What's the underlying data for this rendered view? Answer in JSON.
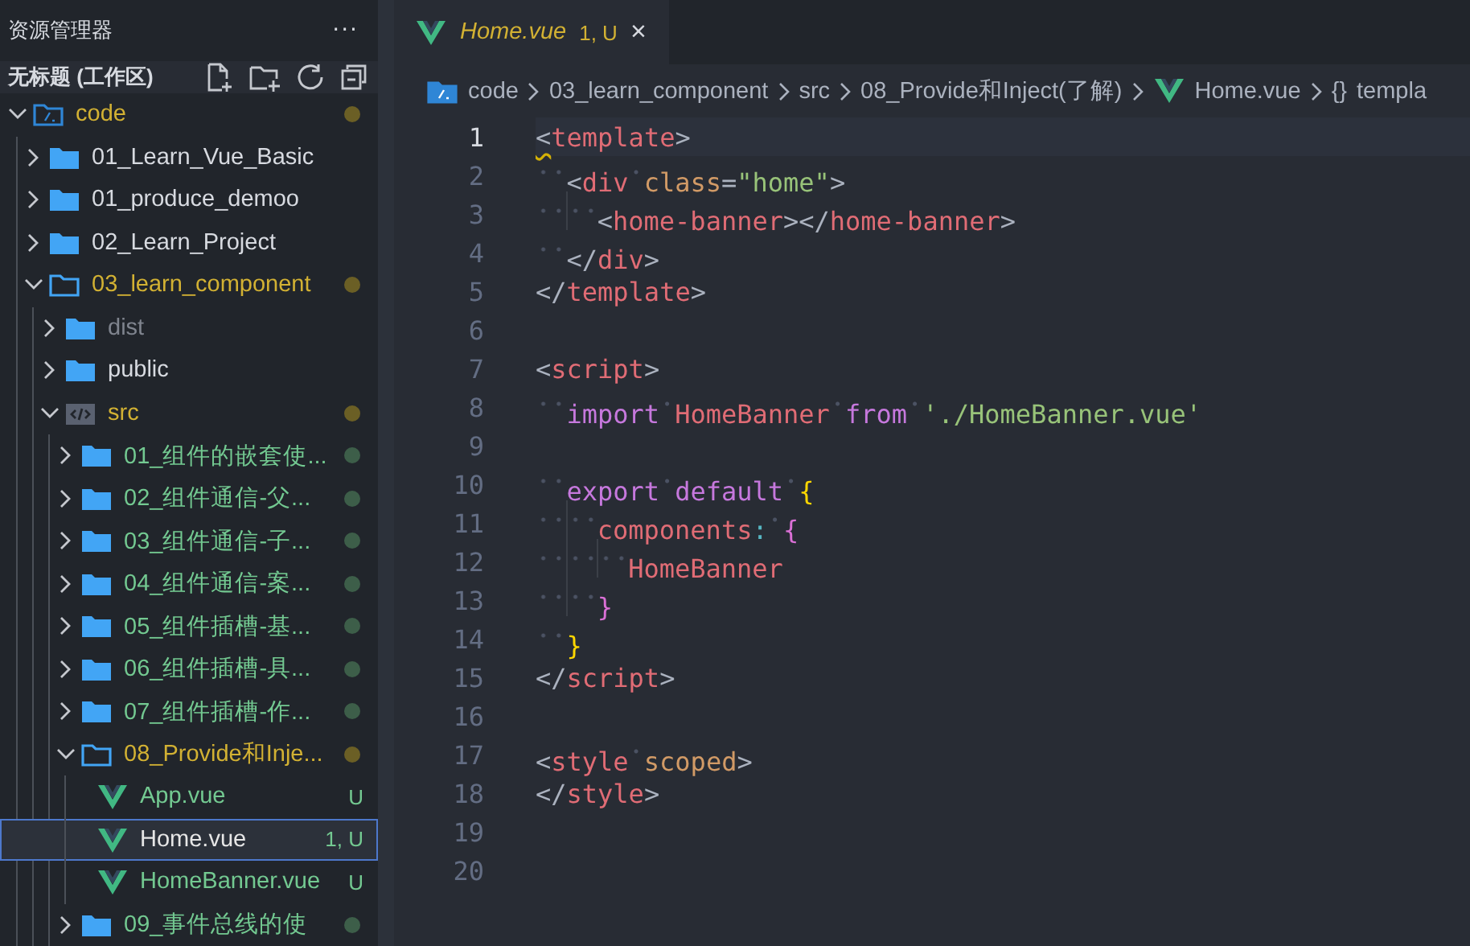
{
  "sidebar": {
    "title": "资源管理器",
    "more": "···",
    "workspace": "无标题 (工作区)",
    "tree": [
      {
        "name": "code",
        "kind": "root",
        "expanded": true,
        "selected": false,
        "color": "#d2b133",
        "dot": {
          "color": "#6b5f25"
        },
        "children": [
          {
            "name": "01_Learn_Vue_Basic",
            "kind": "folder",
            "expanded": false,
            "selected": false,
            "color": "#d7dae0"
          },
          {
            "name": "01_produce_demoo",
            "kind": "folder",
            "expanded": false,
            "selected": false,
            "color": "#d7dae0"
          },
          {
            "name": "02_Learn_Project",
            "kind": "folder",
            "expanded": false,
            "selected": false,
            "color": "#d7dae0"
          },
          {
            "name": "03_learn_component",
            "kind": "folder",
            "expanded": true,
            "selected": false,
            "color": "#d2b133",
            "dot": {
              "color": "#6b5f25"
            },
            "children": [
              {
                "name": "dist",
                "kind": "folder",
                "expanded": false,
                "selected": false,
                "color": "#7f848e"
              },
              {
                "name": "public",
                "kind": "folder",
                "expanded": false,
                "selected": false,
                "color": "#d7dae0"
              },
              {
                "name": "src",
                "kind": "src",
                "expanded": true,
                "selected": false,
                "color": "#d2b133",
                "dot": {
                  "color": "#6b5f25"
                },
                "children": [
                  {
                    "name": "01_组件的嵌套使...",
                    "kind": "folder",
                    "expanded": false,
                    "selected": false,
                    "color": "#73c991",
                    "dot": {
                      "color": "#3d5e49"
                    }
                  },
                  {
                    "name": "02_组件通信-父...",
                    "kind": "folder",
                    "expanded": false,
                    "selected": false,
                    "color": "#73c991",
                    "dot": {
                      "color": "#3d5e49"
                    }
                  },
                  {
                    "name": "03_组件通信-子...",
                    "kind": "folder",
                    "expanded": false,
                    "selected": false,
                    "color": "#73c991",
                    "dot": {
                      "color": "#3d5e49"
                    }
                  },
                  {
                    "name": "04_组件通信-案...",
                    "kind": "folder",
                    "expanded": false,
                    "selected": false,
                    "color": "#73c991",
                    "dot": {
                      "color": "#3d5e49"
                    }
                  },
                  {
                    "name": "05_组件插槽-基...",
                    "kind": "folder",
                    "expanded": false,
                    "selected": false,
                    "color": "#73c991",
                    "dot": {
                      "color": "#3d5e49"
                    }
                  },
                  {
                    "name": "06_组件插槽-具...",
                    "kind": "folder",
                    "expanded": false,
                    "selected": false,
                    "color": "#73c991",
                    "dot": {
                      "color": "#3d5e49"
                    }
                  },
                  {
                    "name": "07_组件插槽-作...",
                    "kind": "folder",
                    "expanded": false,
                    "selected": false,
                    "color": "#73c991",
                    "dot": {
                      "color": "#3d5e49"
                    }
                  },
                  {
                    "name": "08_Provide和Inje...",
                    "kind": "folder",
                    "expanded": true,
                    "selected": false,
                    "color": "#d2b133",
                    "dot": {
                      "color": "#6b5f25"
                    },
                    "children": [
                      {
                        "name": "App.vue",
                        "kind": "vue",
                        "selected": false,
                        "color": "#73c991",
                        "badge": "U"
                      },
                      {
                        "name": "Home.vue",
                        "kind": "vue",
                        "selected": true,
                        "color": "#e6e6e6",
                        "badge": "1, U"
                      },
                      {
                        "name": "HomeBanner.vue",
                        "kind": "vue",
                        "selected": false,
                        "color": "#73c991",
                        "badge": "U"
                      }
                    ]
                  },
                  {
                    "name": "09_事件总线的使",
                    "kind": "folder",
                    "expanded": false,
                    "selected": false,
                    "color": "#73c991",
                    "dot": {
                      "color": "#3d5e49"
                    }
                  }
                ]
              }
            ]
          }
        ]
      }
    ]
  },
  "tabs": [
    {
      "label": "Home.vue",
      "badge": "1, U",
      "close": "×",
      "selected": true
    }
  ],
  "breadcrumbs": [
    {
      "text": "code",
      "kind": "folder"
    },
    {
      "text": "03_learn_component",
      "kind": "plain"
    },
    {
      "text": "src",
      "kind": "plain"
    },
    {
      "text": "08_Provide和Inject(了解)",
      "kind": "plain"
    },
    {
      "text": "Home.vue",
      "kind": "vue"
    },
    {
      "text": "templa",
      "kind": "plain",
      "symbol": "{}"
    }
  ],
  "editor": {
    "lines": [
      {
        "number": "1",
        "current": true,
        "tokens": [
          {
            "text": "<",
            "kind": "punct",
            "squiggle": true
          },
          {
            "text": "template",
            "kind": "tag"
          },
          {
            "text": ">",
            "kind": "punct"
          }
        ]
      },
      {
        "number": "2",
        "current": false,
        "tokens": [
          {
            "kind": "indent"
          },
          {
            "text": "<",
            "kind": "punct"
          },
          {
            "text": "div",
            "kind": "tag"
          },
          {
            "text": "class",
            "kind": "attr",
            "space_before": true
          },
          {
            "text": "=",
            "kind": "punct"
          },
          {
            "text": "\"home\"",
            "kind": "str"
          },
          {
            "text": ">",
            "kind": "punct"
          }
        ]
      },
      {
        "number": "3",
        "current": false,
        "tokens": [
          {
            "kind": "indent"
          },
          {
            "kind": "indent"
          },
          {
            "text": "<",
            "kind": "punct"
          },
          {
            "text": "home-banner",
            "kind": "tag"
          },
          {
            "text": "></",
            "kind": "punct"
          },
          {
            "text": "home-banner",
            "kind": "tag"
          },
          {
            "text": ">",
            "kind": "punct"
          }
        ]
      },
      {
        "number": "4",
        "current": false,
        "tokens": [
          {
            "kind": "indent"
          },
          {
            "text": "</",
            "kind": "punct"
          },
          {
            "text": "div",
            "kind": "tag"
          },
          {
            "text": ">",
            "kind": "punct"
          }
        ]
      },
      {
        "number": "5",
        "current": false,
        "tokens": [
          {
            "text": "</",
            "kind": "punct"
          },
          {
            "text": "template",
            "kind": "tag"
          },
          {
            "text": ">",
            "kind": "punct"
          }
        ]
      },
      {
        "number": "6",
        "current": false
      },
      {
        "number": "7",
        "current": false,
        "tokens": [
          {
            "text": "<",
            "kind": "punct"
          },
          {
            "text": "script",
            "kind": "tag"
          },
          {
            "text": ">",
            "kind": "punct"
          }
        ]
      },
      {
        "number": "8",
        "current": false,
        "tokens": [
          {
            "kind": "indent"
          },
          {
            "text": "import",
            "kind": "kw"
          },
          {
            "text": "HomeBanner",
            "kind": "ident",
            "space_before": true
          },
          {
            "text": "from",
            "kind": "kw",
            "space_before": true
          },
          {
            "text": "'./HomeBanner.vue'",
            "kind": "str",
            "space_before": true
          }
        ]
      },
      {
        "number": "9",
        "current": false
      },
      {
        "number": "10",
        "current": false,
        "tokens": [
          {
            "kind": "indent"
          },
          {
            "text": "export",
            "kind": "kw"
          },
          {
            "text": "default",
            "kind": "kw",
            "space_before": true
          },
          {
            "text": "{",
            "kind": "brace1",
            "space_before": true
          }
        ]
      },
      {
        "number": "11",
        "current": false,
        "tokens": [
          {
            "kind": "indent"
          },
          {
            "kind": "indent"
          },
          {
            "text": "components",
            "kind": "ident"
          },
          {
            "text": ":",
            "kind": "colon"
          },
          {
            "text": "{",
            "kind": "brace2",
            "space_before": true
          }
        ]
      },
      {
        "number": "12",
        "current": false,
        "tokens": [
          {
            "kind": "indent"
          },
          {
            "kind": "indent"
          },
          {
            "kind": "indent"
          },
          {
            "text": "HomeBanner",
            "kind": "ident"
          }
        ]
      },
      {
        "number": "13",
        "current": false,
        "tokens": [
          {
            "kind": "indent"
          },
          {
            "kind": "indent"
          },
          {
            "text": "}",
            "kind": "brace2"
          }
        ]
      },
      {
        "number": "14",
        "current": false,
        "tokens": [
          {
            "kind": "indent"
          },
          {
            "text": "}",
            "kind": "brace1"
          }
        ]
      },
      {
        "number": "15",
        "current": false,
        "tokens": [
          {
            "text": "</",
            "kind": "punct"
          },
          {
            "text": "script",
            "kind": "tag"
          },
          {
            "text": ">",
            "kind": "punct"
          }
        ]
      },
      {
        "number": "16",
        "current": false
      },
      {
        "number": "17",
        "current": false,
        "tokens": [
          {
            "text": "<",
            "kind": "punct"
          },
          {
            "text": "style",
            "kind": "tag"
          },
          {
            "text": "scoped",
            "kind": "attr",
            "space_before": true
          },
          {
            "text": ">",
            "kind": "punct"
          }
        ]
      },
      {
        "number": "18",
        "current": false,
        "tokens": [
          {
            "text": "</",
            "kind": "punct"
          },
          {
            "text": "style",
            "kind": "tag"
          },
          {
            "text": ">",
            "kind": "punct"
          }
        ]
      },
      {
        "number": "19",
        "current": false
      },
      {
        "number": "20",
        "current": false
      }
    ]
  }
}
